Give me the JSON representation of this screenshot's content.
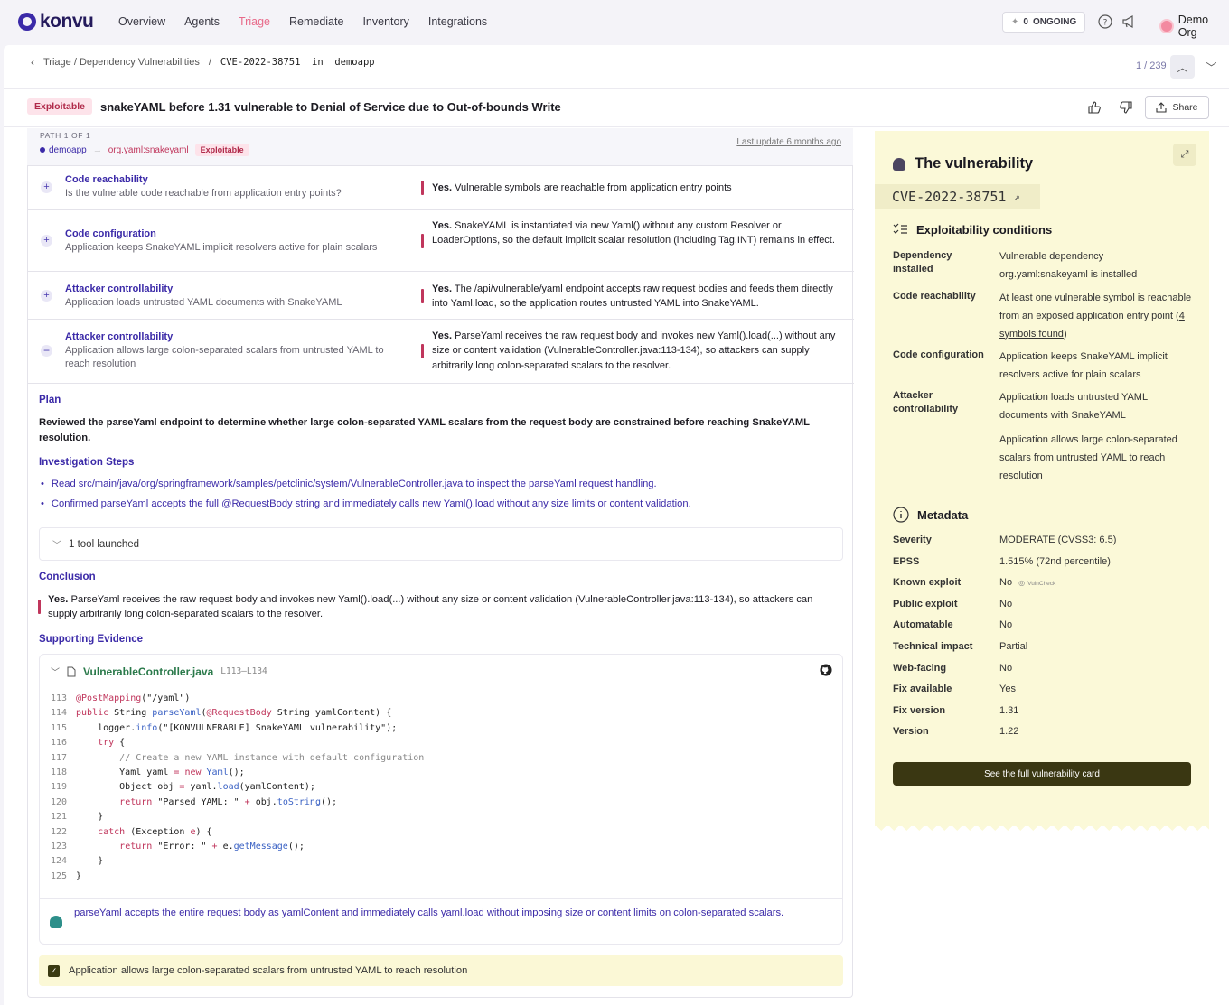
{
  "app": {
    "logo": "konvu"
  },
  "nav": {
    "items": [
      "Overview",
      "Agents",
      "Triage",
      "Remediate",
      "Inventory",
      "Integrations"
    ],
    "active": "Triage"
  },
  "header": {
    "ongoing_count": "0",
    "ongoing_label": "ONGOING",
    "org": "Demo Org"
  },
  "breadcrumb": {
    "path": "Triage / Dependency Vulnerabilities",
    "sep": "/",
    "current": "CVE-2022-38751  in  demoapp"
  },
  "pager": {
    "text": "1 / 239"
  },
  "title": {
    "badge": "Exploitable",
    "text": "snakeYAML before 1.31 vulnerable to Denial of Service due to Out-of-bounds Write",
    "share_label": "Share"
  },
  "path": {
    "label": "PATH 1 OF 1",
    "from": "demoapp",
    "to": "org.yaml:snakeyaml",
    "badge": "Exploitable",
    "last_update": "Last update 6 months ago"
  },
  "conditions": [
    {
      "title": "Code reachability",
      "subtitle": "Is the vulnerable code reachable from application entry points?",
      "answer_bold": "Yes.",
      "answer": " Vulnerable symbols are reachable from application entry points",
      "icon": "plus-icon"
    },
    {
      "title": "Code configuration",
      "subtitle": "Application keeps SnakeYAML implicit resolvers active for plain scalars",
      "answer_bold": "Yes.",
      "answer": " SnakeYAML is instantiated via new Yaml() without any custom Resolver or LoaderOptions, so the default implicit scalar resolution (including Tag.INT) remains in effect.",
      "icon": "plus-icon"
    },
    {
      "title": "Attacker controllability",
      "subtitle": "Application loads untrusted YAML documents with SnakeYAML",
      "answer_bold": "Yes.",
      "answer": " The /api/vulnerable/yaml endpoint accepts raw request bodies and feeds them directly into Yaml.load, so the application routes untrusted YAML into SnakeYAML.",
      "icon": "plus-icon"
    },
    {
      "title": "Attacker controllability",
      "subtitle": "Application allows large colon-separated scalars from untrusted YAML to reach resolution",
      "answer_bold": "Yes.",
      "answer": " ParseYaml receives the raw request body and invokes new Yaml().load(...) without any size or content validation (VulnerableController.java:113-134), so attackers can supply arbitrarily long colon-separated scalars to the resolver.",
      "icon": "minus-icon"
    }
  ],
  "analysis": {
    "plan_heading": "Plan",
    "plan": "Reviewed the parseYaml endpoint to determine whether large colon-separated YAML scalars from the request body are constrained before reaching SnakeYAML resolution.",
    "steps_heading": "Investigation Steps",
    "steps": [
      "Read src/main/java/org/springframework/samples/petclinic/system/VulnerableController.java to inspect the parseYaml request handling.",
      "Confirmed parseYaml accepts the full @RequestBody string and immediately calls new Yaml().load without any size limits or content validation."
    ],
    "tool_label": "1 tool launched",
    "conclusion_heading": "Conclusion",
    "conclusion_bold": "Yes.",
    "conclusion": " ParseYaml receives the raw request body and invokes new Yaml().load(...) without any size or content validation (VulnerableController.java:113-134), so attackers can supply arbitrarily long colon-separated scalars to the resolver.",
    "evidence_heading": "Supporting Evidence",
    "file": "VulnerableController.java",
    "range": "L113–L134",
    "note": "parseYaml accepts the entire request body as yamlContent and immediately calls yaml.load without imposing size or content limits on colon-separated scalars.",
    "evidence_check": "Application allows large colon-separated scalars from untrusted YAML to reach resolution"
  },
  "code_lines": [
    {
      "n": "113",
      "html": "<span class='an'>@PostMapping</span>(\"/yaml\")"
    },
    {
      "n": "114",
      "html": "<span class='kw'>public</span> String <span class='fnc'>parseYaml</span>(<span class='an'>@RequestBody</span> String yamlContent) {"
    },
    {
      "n": "115",
      "html": "    logger.<span class='fnc'>info</span>(\"[KONVULNERABLE] SnakeYAML vulnerability\");"
    },
    {
      "n": "116",
      "html": "    <span class='kw'>try</span> {"
    },
    {
      "n": "117",
      "html": "        <span class='cm'>// Create a new YAML instance with default configuration</span>"
    },
    {
      "n": "118",
      "html": "        Yaml yaml <span class='kw'>=</span> <span class='kw'>new</span> <span class='fnc'>Yaml</span>();"
    },
    {
      "n": "119",
      "html": "        Object obj <span class='kw'>=</span> yaml.<span class='fnc'>load</span>(yamlContent);"
    },
    {
      "n": "120",
      "html": "        <span class='kw'>return</span> \"Parsed YAML: \" <span class='kw'>+</span> obj.<span class='fnc'>toString</span>();"
    },
    {
      "n": "121",
      "html": "    }"
    },
    {
      "n": "122",
      "html": "    <span class='kw'>catch</span> (Exception <span class='kw'>e</span>) {"
    },
    {
      "n": "123",
      "html": "        <span class='kw'>return</span> \"Error: \" <span class='kw'>+</span> e.<span class='fnc'>getMessage</span>();"
    },
    {
      "n": "124",
      "html": "    }"
    },
    {
      "n": "125",
      "html": "}"
    }
  ],
  "side": {
    "title": "The vulnerability",
    "cve": "CVE-2022-38751",
    "exploitability_heading": "Exploitability conditions",
    "dep_k": "Dependency installed",
    "dep_v": "Vulnerable dependency org.yaml:snakeyaml is installed",
    "reach_k": "Code reachability",
    "reach_v1": "At least one vulnerable symbol is reachable from an exposed application entry point (",
    "reach_link": "4 symbols found",
    "reach_v2": ")",
    "conf_k": "Code configuration",
    "conf_v": "Application keeps SnakeYAML implicit resolvers active for plain scalars",
    "att_k": "Attacker controllability",
    "att_v1": "Application loads untrusted YAML documents with SnakeYAML",
    "att_v2": "Application allows large colon-separated scalars from untrusted YAML to reach resolution",
    "metadata_heading": "Metadata",
    "metadata": [
      {
        "k": "Severity",
        "v": "MODERATE (CVSS3: 6.5)"
      },
      {
        "k": "EPSS",
        "v": "1.515% (72nd percentile)"
      },
      {
        "k": "Known exploit",
        "v": "No",
        "extra": "VulnCheck"
      },
      {
        "k": "Public exploit",
        "v": "No"
      },
      {
        "k": "Automatable",
        "v": "No"
      },
      {
        "k": "Technical impact",
        "v": "Partial"
      },
      {
        "k": "Web-facing",
        "v": "No"
      },
      {
        "k": "Fix available",
        "v": "Yes"
      },
      {
        "k": "Fix version",
        "v": "1.31"
      },
      {
        "k": "Version",
        "v": "1.22"
      }
    ],
    "full_card_label": "See the full vulnerability card"
  }
}
